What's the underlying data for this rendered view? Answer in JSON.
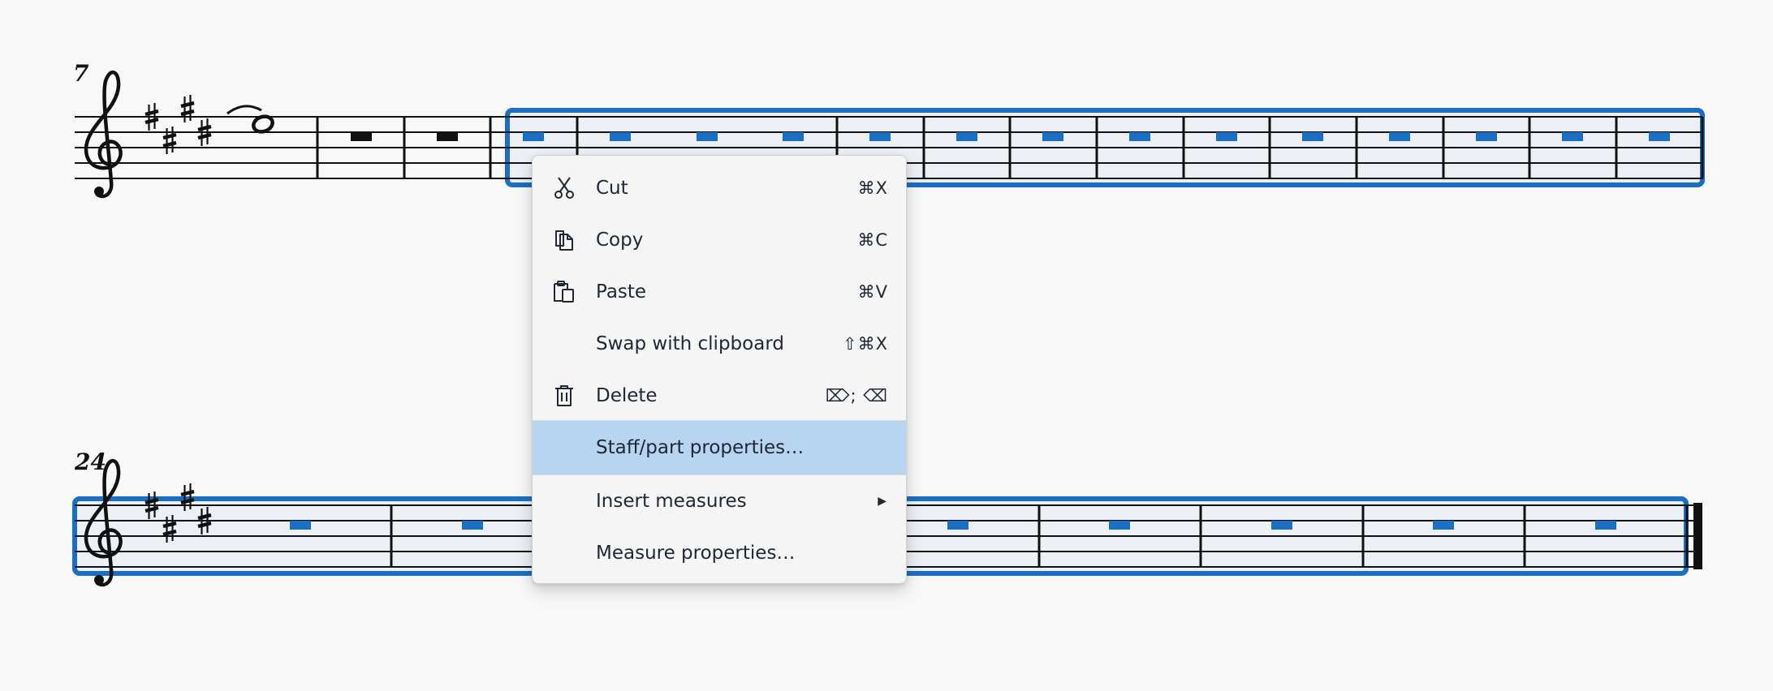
{
  "score": {
    "system1": {
      "measure_number": "7"
    },
    "system2": {
      "measure_number": "24"
    }
  },
  "context_menu": {
    "items": [
      {
        "label": "Cut",
        "shortcut": "⌘X",
        "icon": "scissors-icon"
      },
      {
        "label": "Copy",
        "shortcut": "⌘C",
        "icon": "copy-icon"
      },
      {
        "label": "Paste",
        "shortcut": "⌘V",
        "icon": "paste-icon"
      },
      {
        "label": "Swap with clipboard",
        "shortcut": "⇧⌘X",
        "icon": ""
      },
      {
        "label": "Delete",
        "shortcut": "⌦; ⌫",
        "icon": "trash-icon"
      },
      {
        "label": "Staff/part properties…",
        "shortcut": "",
        "icon": "",
        "highlighted": true
      },
      {
        "label": "Insert measures",
        "shortcut": "",
        "icon": "",
        "submenu": true
      },
      {
        "label": "Measure properties…",
        "shortcut": "",
        "icon": ""
      }
    ]
  },
  "colors": {
    "selection": "#1a6fc2",
    "rest_selected": "#1a6fc2",
    "menu_highlight": "#b7d4f0"
  }
}
